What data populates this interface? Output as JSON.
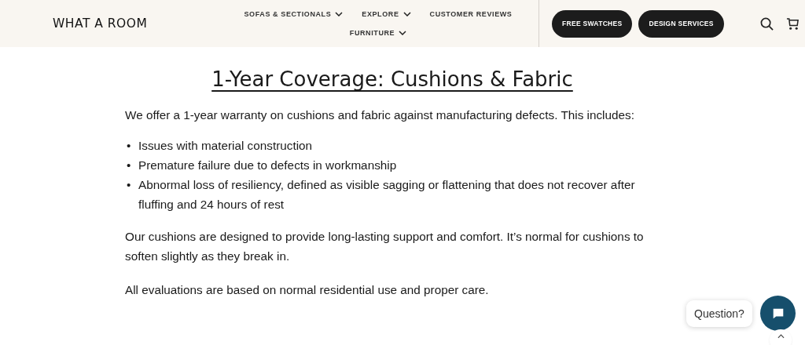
{
  "header": {
    "logo": "WHAT A ROOM",
    "nav": [
      {
        "label": "SOFAS & SECTIONALS",
        "dropdown": true
      },
      {
        "label": "EXPLORE",
        "dropdown": true
      },
      {
        "label": "CUSTOMER REVIEWS",
        "dropdown": false
      },
      {
        "label": "FURNITURE",
        "dropdown": true
      }
    ],
    "buttons": [
      "FREE SWATCHES",
      "DESIGN SERVICES"
    ]
  },
  "content": {
    "heading": "1-Year Coverage: Cushions & Fabric",
    "intro": "We offer a 1-year warranty on cushions and fabric against manufacturing defects. This includes:",
    "bullets": [
      {
        "marker": "•",
        "text": "Issues with material construction"
      },
      {
        "marker": "•",
        "text": "Premature failure due to defects in workmanship"
      },
      {
        "marker": "•",
        "text": "Abnormal loss of resiliency, defined as visible sagging or flattening that does not recover after fluffing and 24 hours of rest"
      }
    ],
    "paragraphs": [
      "Our cushions are designed to provide long-lasting support and comfort. It’s normal for cushions to soften slightly as they break in.",
      "All evaluations are based on normal residential use and proper care."
    ]
  },
  "chat": {
    "prompt": "Question?"
  }
}
